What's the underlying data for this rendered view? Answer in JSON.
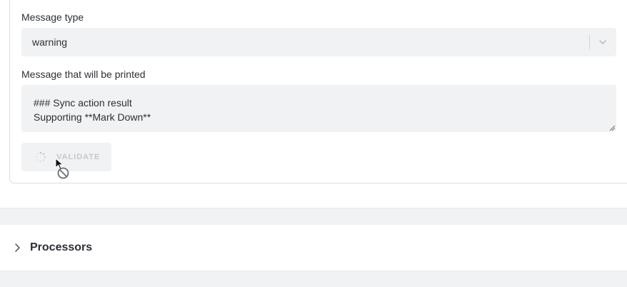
{
  "message_type": {
    "label": "Message type",
    "value": "warning"
  },
  "message_text": {
    "label": "Message that will be printed",
    "value": "### Sync action result\nSupporting **Mark Down**"
  },
  "validate_button": {
    "label": "VALIDATE",
    "state": "loading-disabled"
  },
  "sections": [
    {
      "title": "Processors",
      "expanded": false
    }
  ],
  "icons": {
    "select_chevron": "chevron-down-icon",
    "section_chevron": "chevron-right-icon",
    "spinner": "loading-spinner-icon",
    "cursor": "arrow-cursor-icon",
    "not_allowed": "not-allowed-icon"
  },
  "colors": {
    "field_background": "#f1f2f4",
    "text": "#2b2f36",
    "disabled_text": "#c4c8ce"
  }
}
